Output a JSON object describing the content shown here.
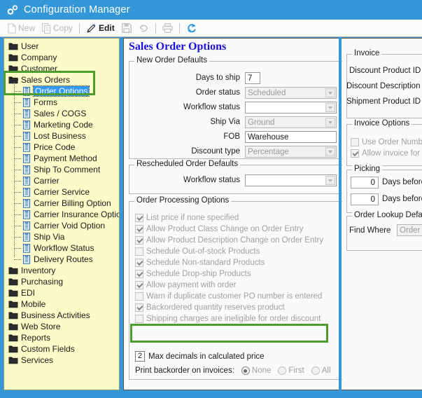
{
  "window": {
    "title": "Configuration Manager",
    "icon": "gears-icon"
  },
  "toolbar": {
    "items": [
      {
        "label": "New",
        "icon": "new-document-icon",
        "enabled": false
      },
      {
        "label": "Copy",
        "icon": "copy-icon",
        "enabled": false
      },
      {
        "label": "Edit",
        "icon": "pencil-icon",
        "enabled": true
      },
      {
        "label": "",
        "icon": "save-disk-icon",
        "enabled": false
      },
      {
        "label": "",
        "icon": "undo-arrow-icon",
        "enabled": false
      },
      {
        "label": "",
        "icon": "print-icon",
        "enabled": false
      },
      {
        "label": "",
        "icon": "refresh-icon",
        "enabled": true
      }
    ]
  },
  "tree": {
    "items": [
      {
        "label": "User",
        "level": 0,
        "type": "folder"
      },
      {
        "label": "Company",
        "level": 0,
        "type": "folder"
      },
      {
        "label": "Customer",
        "level": 0,
        "type": "folder"
      },
      {
        "label": "Sales Orders",
        "level": 0,
        "type": "folder-open"
      },
      {
        "label": "Order Options",
        "level": 1,
        "type": "doc",
        "selected": true
      },
      {
        "label": "Forms",
        "level": 1,
        "type": "doc"
      },
      {
        "label": "Sales / COGS",
        "level": 1,
        "type": "doc"
      },
      {
        "label": "Marketing Code",
        "level": 1,
        "type": "doc"
      },
      {
        "label": "Lost Business",
        "level": 1,
        "type": "doc"
      },
      {
        "label": "Price Code",
        "level": 1,
        "type": "doc"
      },
      {
        "label": "Payment Method",
        "level": 1,
        "type": "doc"
      },
      {
        "label": "Ship To Comment",
        "level": 1,
        "type": "doc"
      },
      {
        "label": "Carrier",
        "level": 1,
        "type": "doc"
      },
      {
        "label": "Carrier Service",
        "level": 1,
        "type": "doc"
      },
      {
        "label": "Carrier Billing Option",
        "level": 1,
        "type": "doc"
      },
      {
        "label": "Carrier Insurance Option",
        "level": 1,
        "type": "doc"
      },
      {
        "label": "Carrier Void Option",
        "level": 1,
        "type": "doc"
      },
      {
        "label": "Ship Via",
        "level": 1,
        "type": "doc"
      },
      {
        "label": "Workflow Status",
        "level": 1,
        "type": "doc"
      },
      {
        "label": "Delivery Routes",
        "level": 1,
        "type": "doc"
      },
      {
        "label": "Inventory",
        "level": 0,
        "type": "folder"
      },
      {
        "label": "Purchasing",
        "level": 0,
        "type": "folder"
      },
      {
        "label": "EDI",
        "level": 0,
        "type": "folder"
      },
      {
        "label": "Mobile",
        "level": 0,
        "type": "folder"
      },
      {
        "label": "Business Activities",
        "level": 0,
        "type": "folder"
      },
      {
        "label": "Web Store",
        "level": 0,
        "type": "folder"
      },
      {
        "label": "Reports",
        "level": 0,
        "type": "folder"
      },
      {
        "label": "Custom Fields",
        "level": 0,
        "type": "folder"
      },
      {
        "label": "Services",
        "level": 0,
        "type": "folder"
      }
    ]
  },
  "main": {
    "page_title": "Sales Order Options",
    "new_order_defaults": {
      "title": "New Order Defaults",
      "fields": [
        {
          "label": "Days to ship",
          "value": "7",
          "kind": "text",
          "disabled": false
        },
        {
          "label": "Order status",
          "value": "Scheduled",
          "kind": "combo",
          "disabled": true
        },
        {
          "label": "Workflow status",
          "value": "",
          "kind": "combo",
          "disabled": true
        },
        {
          "label": "Ship Via",
          "value": "Ground",
          "kind": "combo",
          "disabled": true
        },
        {
          "label": "FOB",
          "value": "Warehouse",
          "kind": "text",
          "disabled": false
        },
        {
          "label": "Discount type",
          "value": "Percentage",
          "kind": "combo",
          "disabled": true
        }
      ]
    },
    "rescheduled_order_defaults": {
      "title": "Rescheduled Order Defaults",
      "fields": [
        {
          "label": "Workflow status",
          "value": "",
          "kind": "combo",
          "disabled": true
        }
      ]
    },
    "order_processing_options": {
      "title": "Order Processing Options",
      "checkboxes": [
        {
          "label": "List price if none specified",
          "checked": true
        },
        {
          "label": "Allow Product Class Change on Order Entry",
          "checked": true
        },
        {
          "label": "Allow Product Description Change on Order Entry",
          "checked": true
        },
        {
          "label": "Schedule Out-of-stock Products",
          "checked": false
        },
        {
          "label": "Schedule Non-standard Products",
          "checked": true
        },
        {
          "label": "Schedule Drop-ship Products",
          "checked": true
        },
        {
          "label": "Allow payment with order",
          "checked": true
        },
        {
          "label": "Warn if duplicate customer PO number is entered",
          "checked": false
        },
        {
          "label": "Backordered quantity reserves product",
          "checked": true
        },
        {
          "label": "Shipping charges are ineligible for order discount",
          "checked": false
        }
      ],
      "max_decimals": {
        "value": "2",
        "label": "Max decimals in calculated price"
      }
    },
    "print_backorder": {
      "label": "Print backorder on invoices:",
      "options": [
        {
          "label": "None",
          "selected": true
        },
        {
          "label": "First",
          "selected": false
        },
        {
          "label": "All",
          "selected": false
        }
      ]
    }
  },
  "right": {
    "invoice": {
      "title": "Invoice",
      "fields": [
        {
          "label": "Discount Product ID"
        },
        {
          "label": "Discount Description"
        },
        {
          "label": "Shipment Product ID"
        }
      ]
    },
    "invoice_options": {
      "title": "Invoice Options",
      "checkboxes": [
        {
          "label": "Use Order Numbe",
          "checked": false
        },
        {
          "label": "Allow invoice for f",
          "checked": true
        }
      ]
    },
    "picking": {
      "title": "Picking",
      "rows": [
        {
          "value": "0",
          "label": "Days before"
        },
        {
          "value": "0",
          "label": "Days before r"
        }
      ]
    },
    "order_lookup": {
      "title": "Order Lookup Default",
      "find_where_label": "Find Where",
      "find_where_value": "Order"
    }
  },
  "colors": {
    "title_bar": "#3498d8",
    "tree_background": "#fbfbc8",
    "highlight_border": "#4c9c2e",
    "selection": "#3399ff",
    "page_title": "#1a12d8"
  }
}
